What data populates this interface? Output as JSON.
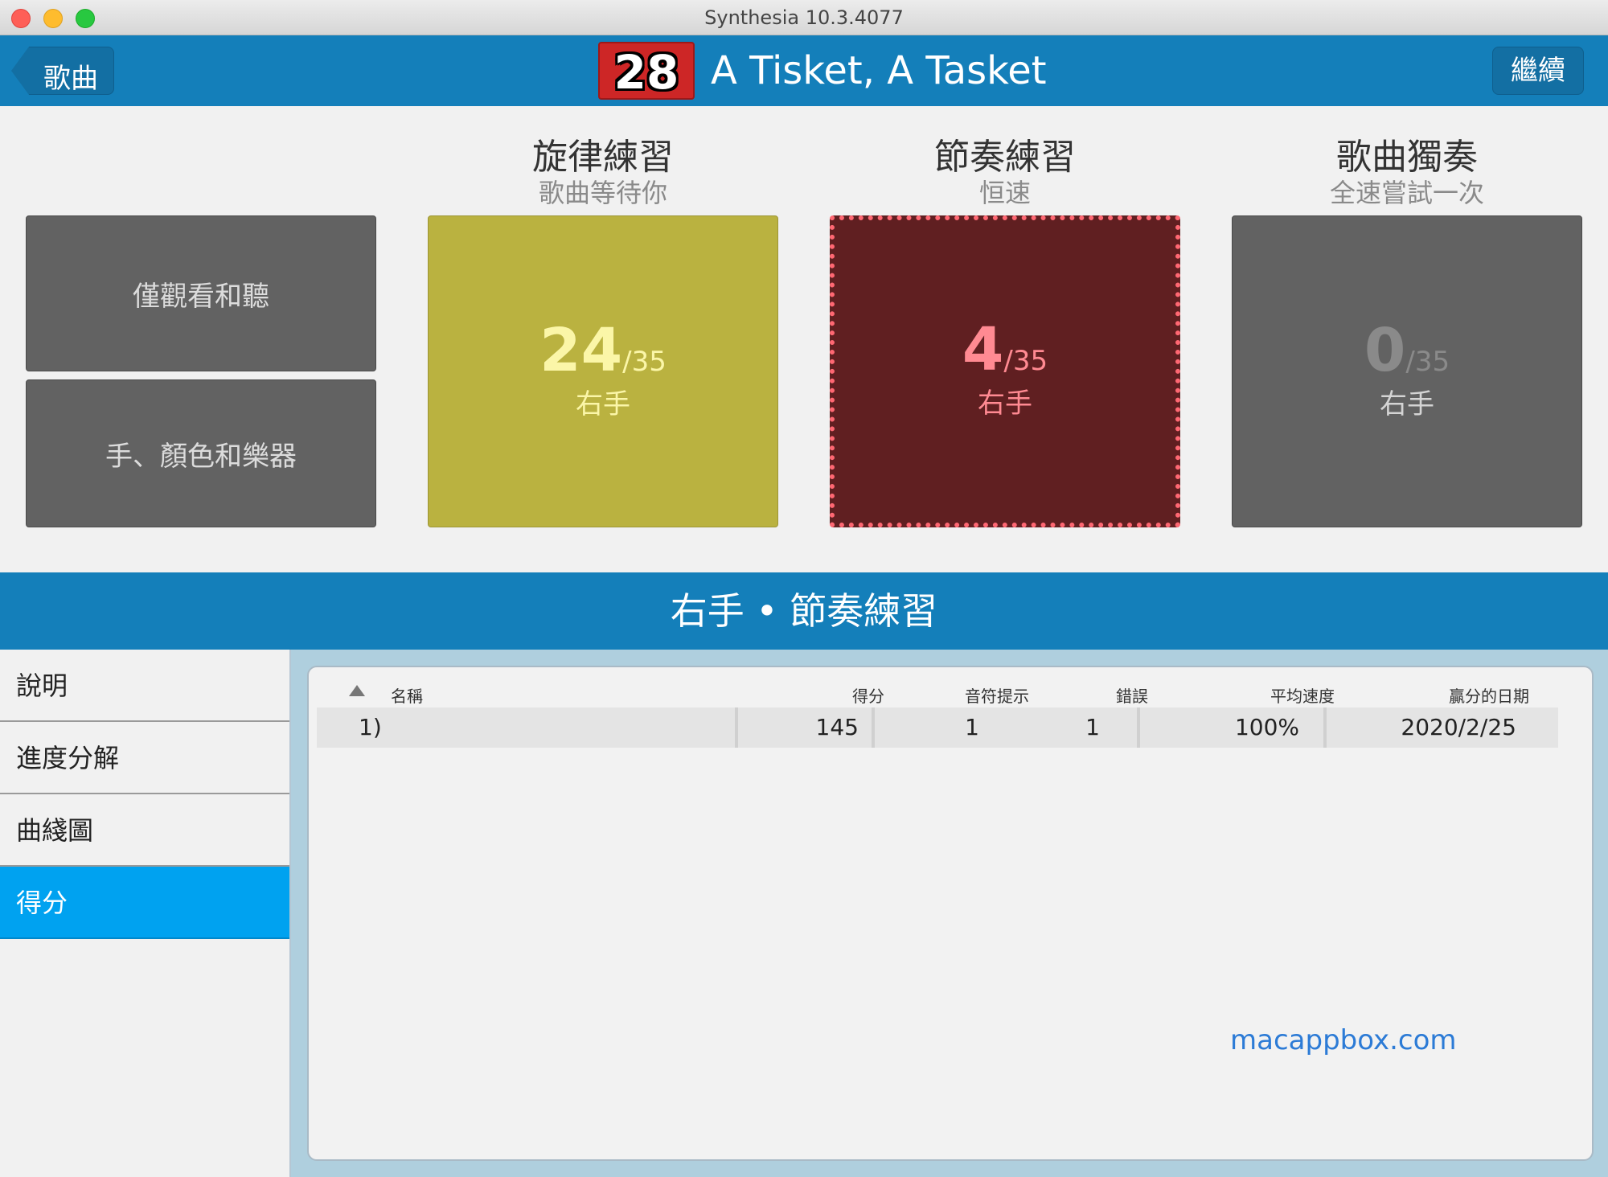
{
  "window": {
    "title": "Synthesia 10.3.4077"
  },
  "header": {
    "back_label": "歌曲",
    "level": "28",
    "song_title": "A Tisket, A Tasket",
    "continue_label": "繼續"
  },
  "left_options": [
    {
      "label": "僅觀看和聽"
    },
    {
      "label": "手、顏色和樂器"
    }
  ],
  "modes": [
    {
      "title": "旋律練習",
      "subtitle": "歌曲等待你",
      "score": "24",
      "total": "/35",
      "hand": "右手"
    },
    {
      "title": "節奏練習",
      "subtitle": "恒速",
      "score": "4",
      "total": "/35",
      "hand": "右手"
    },
    {
      "title": "歌曲獨奏",
      "subtitle": "全速嘗試一次",
      "score": "0",
      "total": "/35",
      "hand": "右手"
    }
  ],
  "section_title": "右手 • 節奏練習",
  "sidebar": {
    "items": [
      {
        "label": "說明"
      },
      {
        "label": "進度分解"
      },
      {
        "label": "曲綫圖"
      },
      {
        "label": "得分",
        "active": true
      }
    ]
  },
  "scores_table": {
    "headers": {
      "name": "名稱",
      "score": "得分",
      "hints": "音符提示",
      "errors": "錯誤",
      "avg_speed": "平均速度",
      "date": "贏分的日期"
    },
    "rows": [
      {
        "rank": "1)",
        "name": "",
        "score": "145",
        "hints": "1",
        "errors": "1",
        "avg_speed": "100%",
        "date": "2020/2/25"
      }
    ]
  },
  "watermark": "macappbox.com",
  "colors": {
    "header_blue": "#147fba",
    "active_tab": "#00a2f0",
    "melody": "#bab240",
    "rhythm": "#601f21",
    "solo": "#626262",
    "badge": "#cd2626"
  }
}
